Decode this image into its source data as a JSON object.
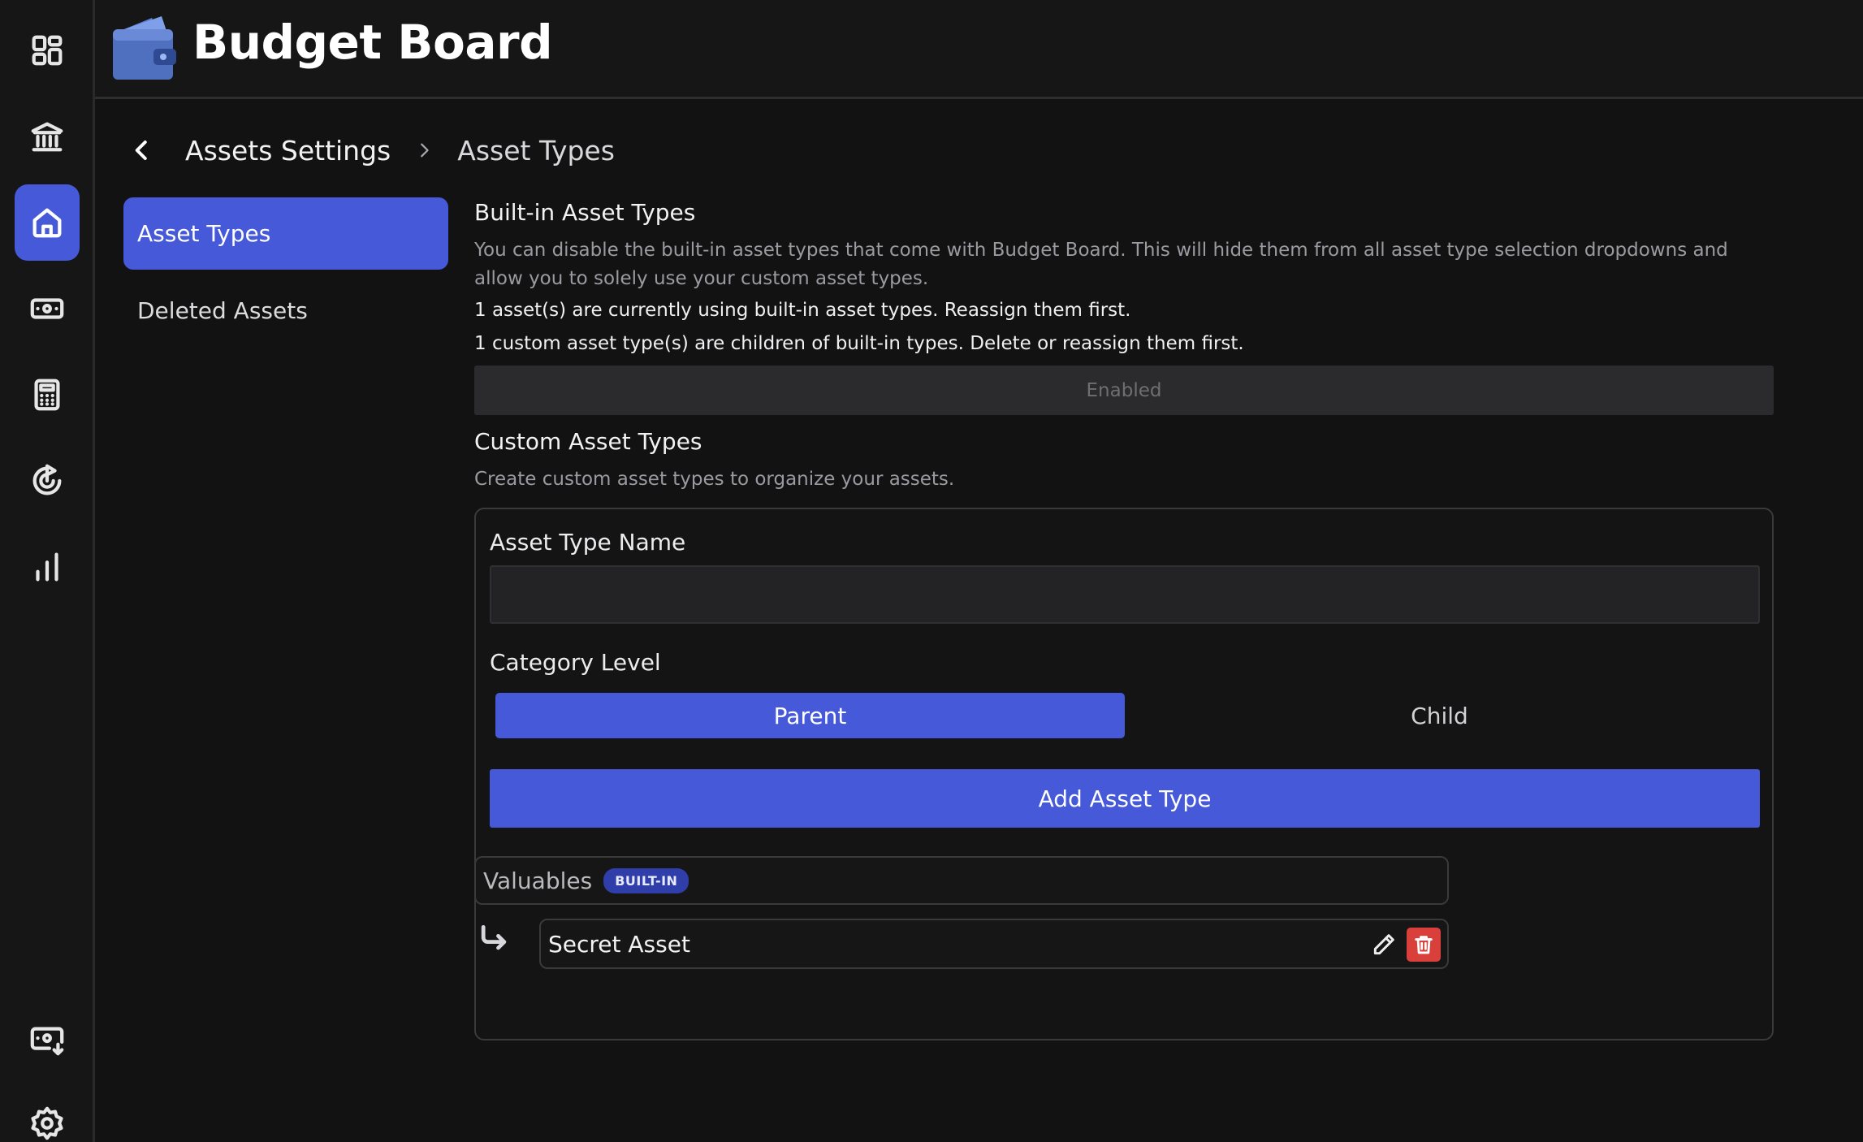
{
  "app": {
    "title": "Budget Board"
  },
  "nav_rail": {
    "items": [
      {
        "icon": "dashboard-icon"
      },
      {
        "icon": "bank-icon"
      },
      {
        "icon": "home-icon",
        "active": true
      },
      {
        "icon": "money-icon"
      },
      {
        "icon": "calculator-icon"
      },
      {
        "icon": "goal-icon"
      },
      {
        "icon": "bar-chart-icon"
      }
    ],
    "bottom_items": [
      {
        "icon": "import-money-icon"
      },
      {
        "icon": "gear-icon"
      }
    ]
  },
  "breadcrumb": {
    "items": [
      "Assets Settings",
      "Asset Types"
    ]
  },
  "subnav": {
    "items": [
      {
        "label": "Asset Types",
        "active": true
      },
      {
        "label": "Deleted Assets",
        "active": false
      }
    ]
  },
  "builtin": {
    "title": "Built-in Asset Types",
    "description": "You can disable the built-in asset types that come with Budget Board. This will hide them from all asset type selection dropdowns and allow you to solely use your custom asset types.",
    "warnings": [
      "1 asset(s) are currently using built-in asset types. Reassign them first.",
      "1 custom asset type(s) are children of built-in types. Delete or reassign them first."
    ],
    "toggle_label": "Enabled"
  },
  "custom": {
    "title": "Custom Asset Types",
    "description": "Create custom asset types to organize your assets.",
    "form": {
      "name_label": "Asset Type Name",
      "name_value": "",
      "category_label": "Category Level",
      "options": [
        "Parent",
        "Child"
      ],
      "selected": "Parent",
      "submit_label": "Add Asset Type"
    },
    "types": [
      {
        "name": "Valuables",
        "badge": "BUILT-IN",
        "children": [
          {
            "name": "Secret Asset"
          }
        ]
      }
    ]
  },
  "colors": {
    "accent": "#4559d9",
    "danger": "#d9403c",
    "background": "#121212"
  }
}
